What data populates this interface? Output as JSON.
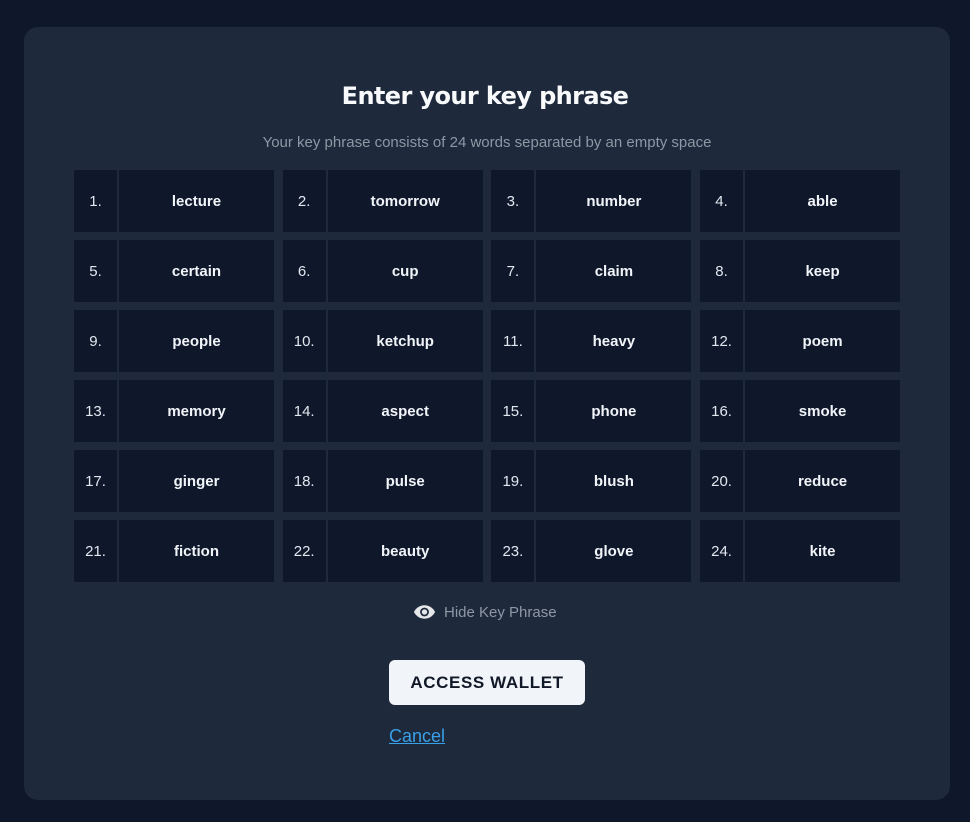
{
  "header": {
    "title": "Enter your key phrase",
    "subtitle": "Your key phrase consists of 24 words separated by an empty space"
  },
  "words": [
    {
      "num": "1.",
      "word": "lecture"
    },
    {
      "num": "2.",
      "word": "tomorrow"
    },
    {
      "num": "3.",
      "word": "number"
    },
    {
      "num": "4.",
      "word": "able"
    },
    {
      "num": "5.",
      "word": "certain"
    },
    {
      "num": "6.",
      "word": "cup"
    },
    {
      "num": "7.",
      "word": "claim"
    },
    {
      "num": "8.",
      "word": "keep"
    },
    {
      "num": "9.",
      "word": "people"
    },
    {
      "num": "10.",
      "word": "ketchup"
    },
    {
      "num": "11.",
      "word": "heavy"
    },
    {
      "num": "12.",
      "word": "poem"
    },
    {
      "num": "13.",
      "word": "memory"
    },
    {
      "num": "14.",
      "word": "aspect"
    },
    {
      "num": "15.",
      "word": "phone"
    },
    {
      "num": "16.",
      "word": "smoke"
    },
    {
      "num": "17.",
      "word": "ginger"
    },
    {
      "num": "18.",
      "word": "pulse"
    },
    {
      "num": "19.",
      "word": "blush"
    },
    {
      "num": "20.",
      "word": "reduce"
    },
    {
      "num": "21.",
      "word": "fiction"
    },
    {
      "num": "22.",
      "word": "beauty"
    },
    {
      "num": "23.",
      "word": "glove"
    },
    {
      "num": "24.",
      "word": "kite"
    }
  ],
  "toggle": {
    "icon": "eye-icon",
    "label": "Hide Key Phrase"
  },
  "actions": {
    "access_label": "ACCESS WALLET",
    "cancel_label": "Cancel"
  },
  "colors": {
    "page_bg": "#0f172a",
    "panel_bg": "#1e293b",
    "cell_bg": "#0f172a",
    "button_bg": "#f1f5f9",
    "link": "#38a0e8",
    "muted_text": "#8e97a4"
  }
}
